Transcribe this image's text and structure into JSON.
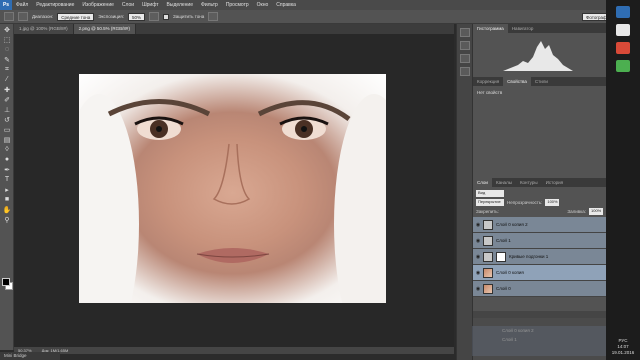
{
  "menubar": {
    "logo": "Ps",
    "items": [
      "Файл",
      "Редактирование",
      "Изображение",
      "Слои",
      "Шрифт",
      "Выделение",
      "Фильтр",
      "Просмотр",
      "Окно",
      "Справка"
    ],
    "controls": [
      "—",
      "□",
      "✕"
    ]
  },
  "optionsbar": {
    "range_label": "Диапазон:",
    "range_value": "Средние тона",
    "exposure_label": "Экспозиция:",
    "exposure_value": "50%",
    "protect_label": "Защитить тона",
    "workspace": "Фотография"
  },
  "document_tabs": [
    "1.jpg @ 100% (RGB/8#)",
    "2.png @ 50.5% (RGB/8#)"
  ],
  "statusbar": {
    "zoom": "50.37%",
    "doc": "Док: 1M/1.65M"
  },
  "minibridge": "Mini Bridge",
  "panels": {
    "histogram_tabs": [
      "Гистограмма",
      "Навигатор"
    ],
    "props_tabs": [
      "Коррекция",
      "Свойства",
      "Стили"
    ],
    "props_text": "Нет свойств",
    "layers_tabs": [
      "Слои",
      "Каналы",
      "Контуры",
      "История"
    ],
    "filter_label": "Вид",
    "blend_mode": "Перекрытие",
    "opacity_label": "Непрозрачность:",
    "opacity_value": "100%",
    "lock_label": "Закрепить:",
    "fill_label": "Заливка:",
    "fill_value": "100%",
    "layers": [
      {
        "name": "Слой 0 копия 2",
        "thumb": "gray",
        "active": false
      },
      {
        "name": "Слой 1",
        "thumb": "gray",
        "active": false
      },
      {
        "name": "Кривые подгонки 1",
        "thumb": "mask",
        "active": false
      },
      {
        "name": "Слой 0 копия",
        "thumb": "photo",
        "active": true
      },
      {
        "name": "Слой 0",
        "thumb": "photo",
        "active": false
      }
    ],
    "ghost_layers": [
      "Слой 0 копия 2",
      "Слой 1"
    ]
  },
  "taskbar": {
    "lang": "РУС",
    "time": "14:07",
    "date": "19.01.2016"
  }
}
